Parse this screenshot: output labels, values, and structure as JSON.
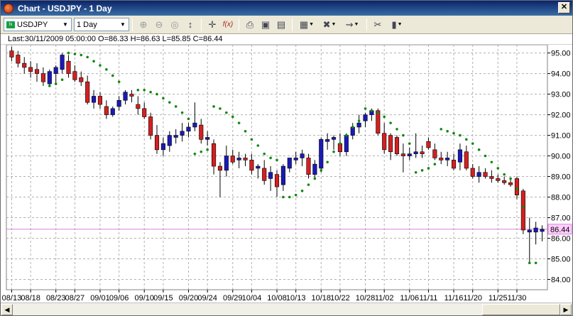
{
  "window": {
    "title": "Chart - USDJPY - 1 Day",
    "close_label": "✕"
  },
  "toolbar": {
    "symbol_value": "USDJPY",
    "timeframe_value": "1 Day",
    "buttons": [
      {
        "name": "zoom-in-icon",
        "glyph": "⊕",
        "dim": true
      },
      {
        "name": "zoom-out-icon",
        "glyph": "⊖",
        "dim": true
      },
      {
        "name": "zoom-fit-icon",
        "glyph": "◎",
        "dim": true
      },
      {
        "name": "trendline-icon",
        "glyph": "↕",
        "dim": false
      },
      {
        "name": "crosshair-icon",
        "glyph": "✛",
        "dim": false
      },
      {
        "name": "formula-icon",
        "glyph": "f(x)",
        "dim": false
      },
      {
        "name": "print-icon",
        "glyph": "⎙",
        "dim": false
      },
      {
        "name": "save-icon",
        "glyph": "▣",
        "dim": false
      },
      {
        "name": "document-icon",
        "glyph": "▤",
        "dim": false
      },
      {
        "name": "grid-icon",
        "glyph": "▦",
        "dim": false,
        "dropdown": true
      },
      {
        "name": "delete-icon",
        "glyph": "✖",
        "dim": false,
        "dropdown": true
      },
      {
        "name": "indicator-icon",
        "glyph": "⇝",
        "dim": false,
        "dropdown": true
      },
      {
        "name": "tools-icon",
        "glyph": "✂",
        "dim": false
      },
      {
        "name": "chart-type-icon",
        "glyph": "▮",
        "dim": false,
        "dropdown": true
      }
    ]
  },
  "info": {
    "text": "Last:30/11/2009 05:00:00 O=86.33 H=86.63 L=85.85 C=86.44"
  },
  "colors": {
    "up": "#1a1ab8",
    "down": "#d42020",
    "sar": "#118811",
    "last_line": "#e080e0",
    "grid": "#b0b0b0",
    "last_label_bg": "#ffd0ff"
  },
  "chart_data": {
    "type": "candlestick",
    "symbol": "USDJPY",
    "ylim": [
      83.5,
      95.4
    ],
    "y_ticks": [
      84.0,
      85.0,
      86.0,
      87.0,
      88.0,
      89.0,
      90.0,
      91.0,
      92.0,
      93.0,
      94.0,
      95.0
    ],
    "last_price": 86.44,
    "last_price_label": "86.44",
    "x_tick_labels": [
      "08/13",
      "08/18",
      "08/23",
      "08/27",
      "09/01",
      "09/06",
      "09/10",
      "09/15",
      "09/20",
      "09/24",
      "09/29",
      "10/04",
      "10/08",
      "10/13",
      "10/18",
      "10/22",
      "10/28",
      "11/02",
      "11/06",
      "11/11",
      "11/16",
      "11/20",
      "11/25",
      "11/30"
    ],
    "x_tick_bar_index": [
      0,
      3,
      7,
      10,
      14,
      17,
      21,
      24,
      28,
      31,
      35,
      38,
      42,
      45,
      49,
      52,
      56,
      59,
      63,
      66,
      70,
      73,
      77,
      80
    ],
    "ohlc": [
      [
        95.1,
        95.3,
        94.6,
        94.8
      ],
      [
        94.9,
        95.1,
        94.3,
        94.5
      ],
      [
        94.5,
        94.8,
        94.0,
        94.3
      ],
      [
        94.3,
        94.6,
        93.8,
        94.1
      ],
      [
        94.2,
        94.5,
        93.6,
        94.0
      ],
      [
        94.0,
        94.3,
        93.4,
        93.6
      ],
      [
        93.5,
        94.2,
        93.4,
        94.1
      ],
      [
        94.0,
        94.4,
        93.5,
        94.3
      ],
      [
        94.2,
        95.0,
        94.0,
        94.9
      ],
      [
        94.6,
        94.9,
        93.8,
        94.0
      ],
      [
        94.1,
        94.4,
        93.6,
        93.7
      ],
      [
        93.8,
        94.1,
        93.4,
        93.6
      ],
      [
        93.6,
        93.9,
        92.5,
        92.6
      ],
      [
        92.6,
        93.2,
        92.3,
        92.9
      ],
      [
        92.9,
        93.1,
        92.3,
        92.5
      ],
      [
        92.4,
        92.7,
        91.8,
        92.0
      ],
      [
        92.0,
        92.4,
        91.9,
        92.3
      ],
      [
        92.4,
        92.9,
        92.2,
        92.7
      ],
      [
        92.7,
        93.2,
        92.5,
        93.1
      ],
      [
        93.0,
        93.2,
        92.6,
        92.9
      ],
      [
        92.5,
        92.9,
        92.0,
        92.3
      ],
      [
        92.3,
        92.6,
        91.8,
        91.9
      ],
      [
        91.9,
        92.1,
        90.8,
        91.0
      ],
      [
        91.0,
        91.5,
        90.1,
        90.3
      ],
      [
        90.3,
        90.9,
        90.0,
        90.6
      ],
      [
        90.5,
        91.2,
        90.2,
        91.0
      ],
      [
        90.9,
        91.3,
        90.6,
        91.0
      ],
      [
        91.0,
        91.6,
        90.7,
        91.2
      ],
      [
        91.2,
        91.6,
        90.9,
        91.4
      ],
      [
        91.4,
        92.6,
        91.2,
        91.6
      ],
      [
        91.5,
        91.8,
        90.6,
        90.8
      ],
      [
        90.8,
        91.2,
        90.5,
        90.9
      ],
      [
        90.6,
        90.8,
        89.1,
        89.5
      ],
      [
        89.5,
        89.7,
        88.0,
        89.3
      ],
      [
        89.3,
        90.5,
        89.0,
        90.0
      ],
      [
        90.0,
        90.3,
        89.6,
        89.7
      ],
      [
        89.8,
        90.2,
        89.4,
        89.9
      ],
      [
        89.9,
        90.1,
        89.5,
        89.8
      ],
      [
        89.8,
        90.1,
        89.1,
        89.3
      ],
      [
        89.4,
        89.6,
        88.9,
        89.5
      ],
      [
        89.4,
        89.8,
        88.6,
        88.8
      ],
      [
        88.9,
        89.5,
        88.3,
        89.2
      ],
      [
        89.1,
        89.3,
        88.0,
        88.5
      ],
      [
        88.6,
        89.6,
        88.3,
        89.5
      ],
      [
        89.4,
        89.9,
        89.2,
        89.9
      ],
      [
        89.8,
        90.2,
        89.6,
        89.9
      ],
      [
        89.9,
        90.3,
        89.5,
        90.1
      ],
      [
        89.9,
        90.1,
        88.9,
        89.1
      ],
      [
        89.1,
        89.8,
        88.9,
        89.6
      ],
      [
        89.4,
        90.9,
        89.2,
        90.8
      ],
      [
        90.7,
        91.1,
        90.3,
        90.8
      ],
      [
        90.8,
        91.0,
        90.3,
        90.9
      ],
      [
        90.6,
        91.1,
        90.0,
        90.2
      ],
      [
        90.2,
        91.1,
        90.0,
        91.0
      ],
      [
        91.0,
        91.6,
        90.8,
        91.4
      ],
      [
        91.4,
        92.0,
        91.1,
        91.6
      ],
      [
        91.7,
        92.1,
        91.4,
        92.0
      ],
      [
        92.0,
        92.3,
        91.7,
        92.2
      ],
      [
        92.2,
        92.3,
        91.0,
        91.1
      ],
      [
        91.1,
        91.6,
        90.1,
        90.3
      ],
      [
        91.0,
        91.1,
        89.8,
        90.2
      ],
      [
        90.9,
        91.0,
        90.0,
        90.1
      ],
      [
        90.1,
        90.6,
        89.2,
        90.0
      ],
      [
        90.0,
        90.4,
        89.8,
        90.1
      ],
      [
        90.1,
        91.1,
        89.9,
        90.2
      ],
      [
        90.2,
        90.5,
        89.9,
        90.1
      ],
      [
        90.7,
        90.9,
        90.3,
        90.4
      ],
      [
        90.3,
        90.6,
        89.8,
        89.9
      ],
      [
        89.9,
        90.2,
        89.6,
        89.8
      ],
      [
        89.8,
        90.2,
        89.5,
        89.9
      ],
      [
        89.8,
        90.1,
        89.3,
        89.4
      ],
      [
        89.7,
        90.6,
        89.3,
        90.3
      ],
      [
        90.2,
        90.5,
        89.3,
        89.4
      ],
      [
        89.4,
        89.6,
        88.9,
        89.0
      ],
      [
        89.0,
        89.5,
        88.7,
        89.2
      ],
      [
        89.2,
        89.4,
        88.9,
        89.0
      ],
      [
        89.0,
        89.3,
        88.7,
        88.9
      ],
      [
        88.9,
        89.1,
        88.7,
        88.8
      ],
      [
        88.8,
        89.0,
        88.6,
        88.7
      ],
      [
        88.7,
        88.9,
        88.5,
        88.6
      ],
      [
        88.9,
        89.0,
        87.9,
        88.1
      ],
      [
        88.3,
        88.4,
        86.2,
        86.4
      ],
      [
        86.3,
        87.0,
        84.8,
        86.4
      ],
      [
        86.3,
        86.8,
        85.7,
        86.5
      ],
      [
        86.33,
        86.63,
        85.85,
        86.44
      ]
    ],
    "sar": [
      {
        "i": 6,
        "v": 93.4
      },
      {
        "i": 7,
        "v": 93.5
      },
      {
        "i": 8,
        "v": 93.7
      },
      {
        "i": 9,
        "v": 95.0
      },
      {
        "i": 10,
        "v": 94.95
      },
      {
        "i": 11,
        "v": 94.9
      },
      {
        "i": 12,
        "v": 94.8
      },
      {
        "i": 13,
        "v": 94.6
      },
      {
        "i": 14,
        "v": 94.4
      },
      {
        "i": 15,
        "v": 94.2
      },
      {
        "i": 16,
        "v": 93.9
      },
      {
        "i": 17,
        "v": 93.6
      },
      {
        "i": 20,
        "v": 93.2
      },
      {
        "i": 21,
        "v": 93.2
      },
      {
        "i": 22,
        "v": 93.1
      },
      {
        "i": 23,
        "v": 93.0
      },
      {
        "i": 24,
        "v": 92.8
      },
      {
        "i": 25,
        "v": 92.6
      },
      {
        "i": 26,
        "v": 92.4
      },
      {
        "i": 27,
        "v": 92.1
      },
      {
        "i": 28,
        "v": 91.8
      },
      {
        "i": 29,
        "v": 90.1
      },
      {
        "i": 30,
        "v": 90.2
      },
      {
        "i": 31,
        "v": 90.3
      },
      {
        "i": 32,
        "v": 92.4
      },
      {
        "i": 33,
        "v": 92.3
      },
      {
        "i": 34,
        "v": 92.1
      },
      {
        "i": 35,
        "v": 91.9
      },
      {
        "i": 36,
        "v": 91.6
      },
      {
        "i": 37,
        "v": 91.2
      },
      {
        "i": 38,
        "v": 90.8
      },
      {
        "i": 39,
        "v": 90.5
      },
      {
        "i": 40,
        "v": 90.1
      },
      {
        "i": 41,
        "v": 89.9
      },
      {
        "i": 42,
        "v": 89.8
      },
      {
        "i": 43,
        "v": 88.0
      },
      {
        "i": 44,
        "v": 88.0
      },
      {
        "i": 45,
        "v": 88.1
      },
      {
        "i": 46,
        "v": 88.3
      },
      {
        "i": 47,
        "v": 88.6
      },
      {
        "i": 48,
        "v": 88.9
      },
      {
        "i": 49,
        "v": 89.3
      },
      {
        "i": 50,
        "v": 89.7
      },
      {
        "i": 51,
        "v": 90.2
      },
      {
        "i": 52,
        "v": 90.6
      },
      {
        "i": 53,
        "v": 91.0
      },
      {
        "i": 54,
        "v": 91.4
      },
      {
        "i": 55,
        "v": 91.7
      },
      {
        "i": 56,
        "v": 92.3
      },
      {
        "i": 57,
        "v": 92.2
      },
      {
        "i": 58,
        "v": 92.1
      },
      {
        "i": 59,
        "v": 91.9
      },
      {
        "i": 60,
        "v": 91.6
      },
      {
        "i": 61,
        "v": 91.3
      },
      {
        "i": 62,
        "v": 91.0
      },
      {
        "i": 63,
        "v": 90.6
      },
      {
        "i": 64,
        "v": 89.2
      },
      {
        "i": 65,
        "v": 89.3
      },
      {
        "i": 66,
        "v": 89.4
      },
      {
        "i": 67,
        "v": 89.6
      },
      {
        "i": 68,
        "v": 91.3
      },
      {
        "i": 69,
        "v": 91.2
      },
      {
        "i": 70,
        "v": 91.1
      },
      {
        "i": 71,
        "v": 91.0
      },
      {
        "i": 72,
        "v": 90.8
      },
      {
        "i": 73,
        "v": 90.6
      },
      {
        "i": 74,
        "v": 90.3
      },
      {
        "i": 75,
        "v": 90.0
      },
      {
        "i": 76,
        "v": 89.7
      },
      {
        "i": 77,
        "v": 89.4
      },
      {
        "i": 78,
        "v": 89.1
      },
      {
        "i": 79,
        "v": 88.9
      },
      {
        "i": 80,
        "v": 88.4
      },
      {
        "i": 81,
        "v": 87.5
      },
      {
        "i": 82,
        "v": 84.8
      },
      {
        "i": 83,
        "v": 84.8
      }
    ]
  }
}
